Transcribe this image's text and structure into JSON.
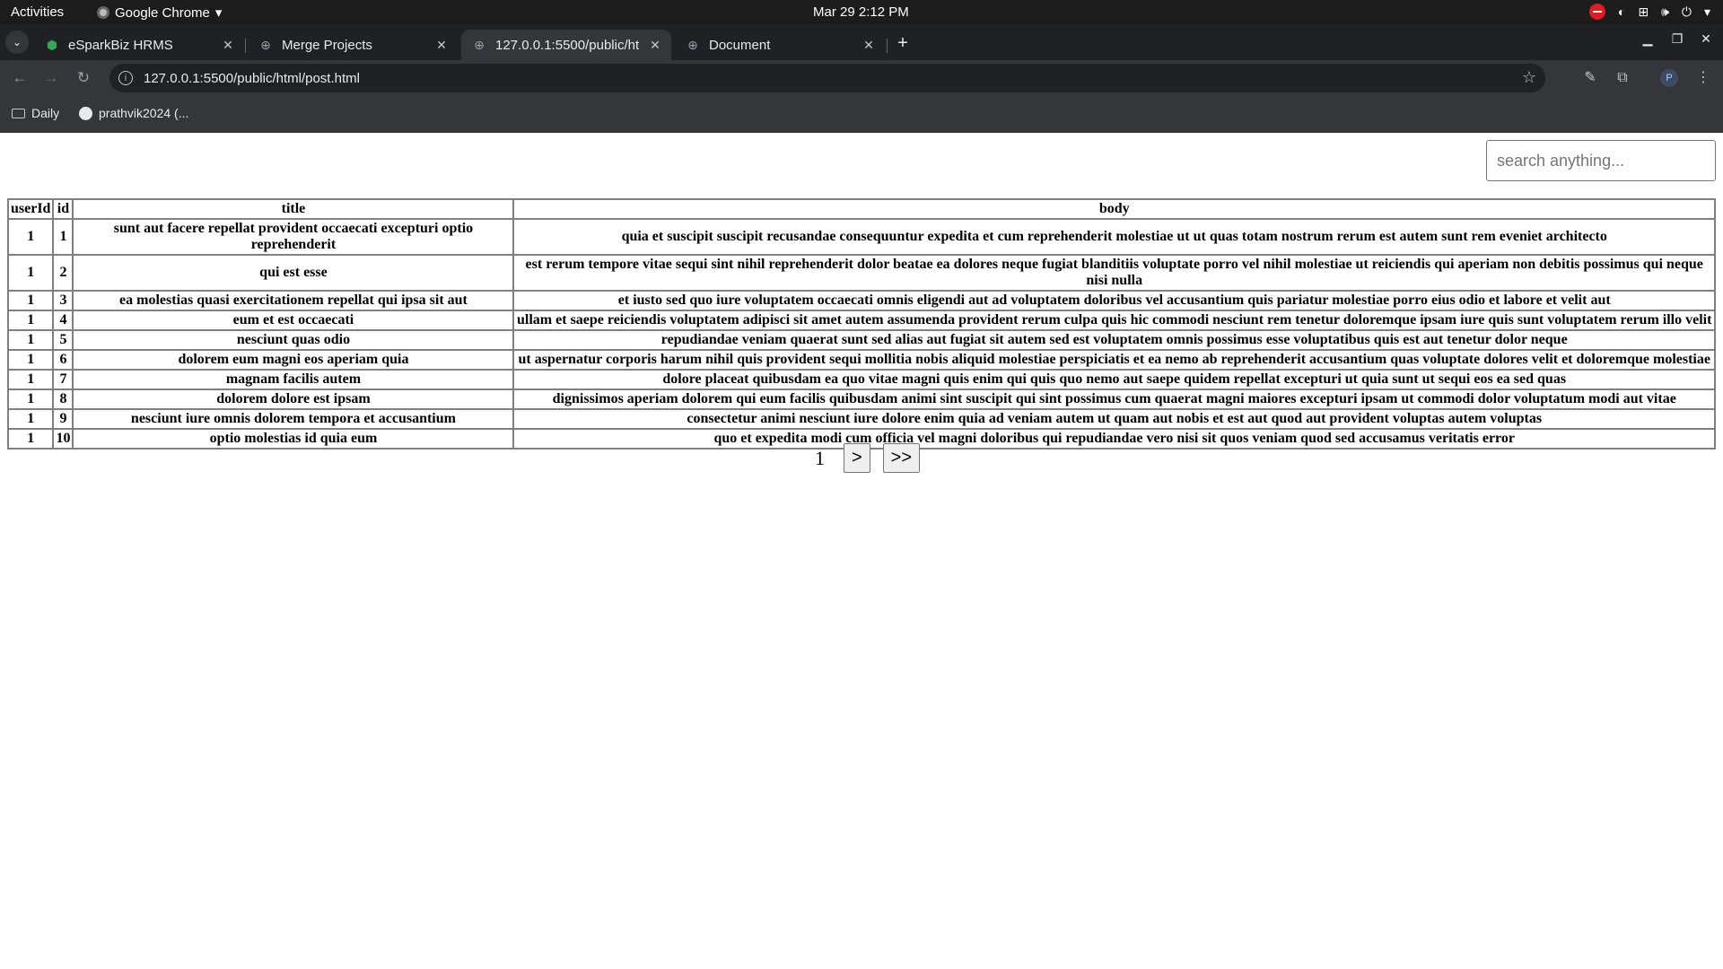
{
  "system_bar": {
    "activities": "Activities",
    "app_name": "Google Chrome",
    "clock": "Mar 29  2:12 PM"
  },
  "browser": {
    "tabs": [
      {
        "title": "eSparkBiz HRMS",
        "icon": "esparkbiz-icon",
        "active": false
      },
      {
        "title": "Merge Projects",
        "icon": "globe-icon",
        "active": false
      },
      {
        "title": "127.0.0.1:5500/public/ht",
        "icon": "globe-icon",
        "active": true
      },
      {
        "title": "Document",
        "icon": "globe-icon",
        "active": false
      }
    ],
    "url": "127.0.0.1:5500/public/html/post.html",
    "profile_initial": "P",
    "bookmarks": [
      {
        "label": "Daily",
        "icon": "folder-icon"
      },
      {
        "label": "prathvik2024 (...",
        "icon": "github-icon"
      }
    ]
  },
  "search": {
    "placeholder": "search anything...",
    "value": ""
  },
  "table": {
    "headers": [
      "userId",
      "id",
      "title",
      "body"
    ],
    "rows": [
      {
        "userId": "1",
        "id": "1",
        "title": "sunt aut facere repellat provident occaecati excepturi optio reprehenderit",
        "body": "quia et suscipit suscipit recusandae consequuntur expedita et cum reprehenderit molestiae ut ut quas totam nostrum rerum est autem sunt rem eveniet architecto"
      },
      {
        "userId": "1",
        "id": "2",
        "title": "qui est esse",
        "body": "est rerum tempore vitae sequi sint nihil reprehenderit dolor beatae ea dolores neque fugiat blanditiis voluptate porro vel nihil molestiae ut reiciendis qui aperiam non debitis possimus qui neque nisi nulla"
      },
      {
        "userId": "1",
        "id": "3",
        "title": "ea molestias quasi exercitationem repellat qui ipsa sit aut",
        "body": "et iusto sed quo iure voluptatem occaecati omnis eligendi aut ad voluptatem doloribus vel accusantium quis pariatur molestiae porro eius odio et labore et velit aut"
      },
      {
        "userId": "1",
        "id": "4",
        "title": "eum et est occaecati",
        "body": "ullam et saepe reiciendis voluptatem adipisci sit amet autem assumenda provident rerum culpa quis hic commodi nesciunt rem tenetur doloremque ipsam iure quis sunt voluptatem rerum illo velit"
      },
      {
        "userId": "1",
        "id": "5",
        "title": "nesciunt quas odio",
        "body": "repudiandae veniam quaerat sunt sed alias aut fugiat sit autem sed est voluptatem omnis possimus esse voluptatibus quis est aut tenetur dolor neque"
      },
      {
        "userId": "1",
        "id": "6",
        "title": "dolorem eum magni eos aperiam quia",
        "body": "ut aspernatur corporis harum nihil quis provident sequi mollitia nobis aliquid molestiae perspiciatis et ea nemo ab reprehenderit accusantium quas voluptate dolores velit et doloremque molestiae"
      },
      {
        "userId": "1",
        "id": "7",
        "title": "magnam facilis autem",
        "body": "dolore placeat quibusdam ea quo vitae magni quis enim qui quis quo nemo aut saepe quidem repellat excepturi ut quia sunt ut sequi eos ea sed quas"
      },
      {
        "userId": "1",
        "id": "8",
        "title": "dolorem dolore est ipsam",
        "body": "dignissimos aperiam dolorem qui eum facilis quibusdam animi sint suscipit qui sint possimus cum quaerat magni maiores excepturi ipsam ut commodi dolor voluptatum modi aut vitae"
      },
      {
        "userId": "1",
        "id": "9",
        "title": "nesciunt iure omnis dolorem tempora et accusantium",
        "body": "consectetur animi nesciunt iure dolore enim quia ad veniam autem ut quam aut nobis et est aut quod aut provident voluptas autem voluptas"
      },
      {
        "userId": "1",
        "id": "10",
        "title": "optio molestias id quia eum",
        "body": "quo et expedita modi cum officia vel magni doloribus qui repudiandae vero nisi sit quos veniam quod sed accusamus veritatis error"
      }
    ]
  },
  "pagination": {
    "current_page": "1",
    "next_label": ">",
    "last_label": ">>"
  }
}
